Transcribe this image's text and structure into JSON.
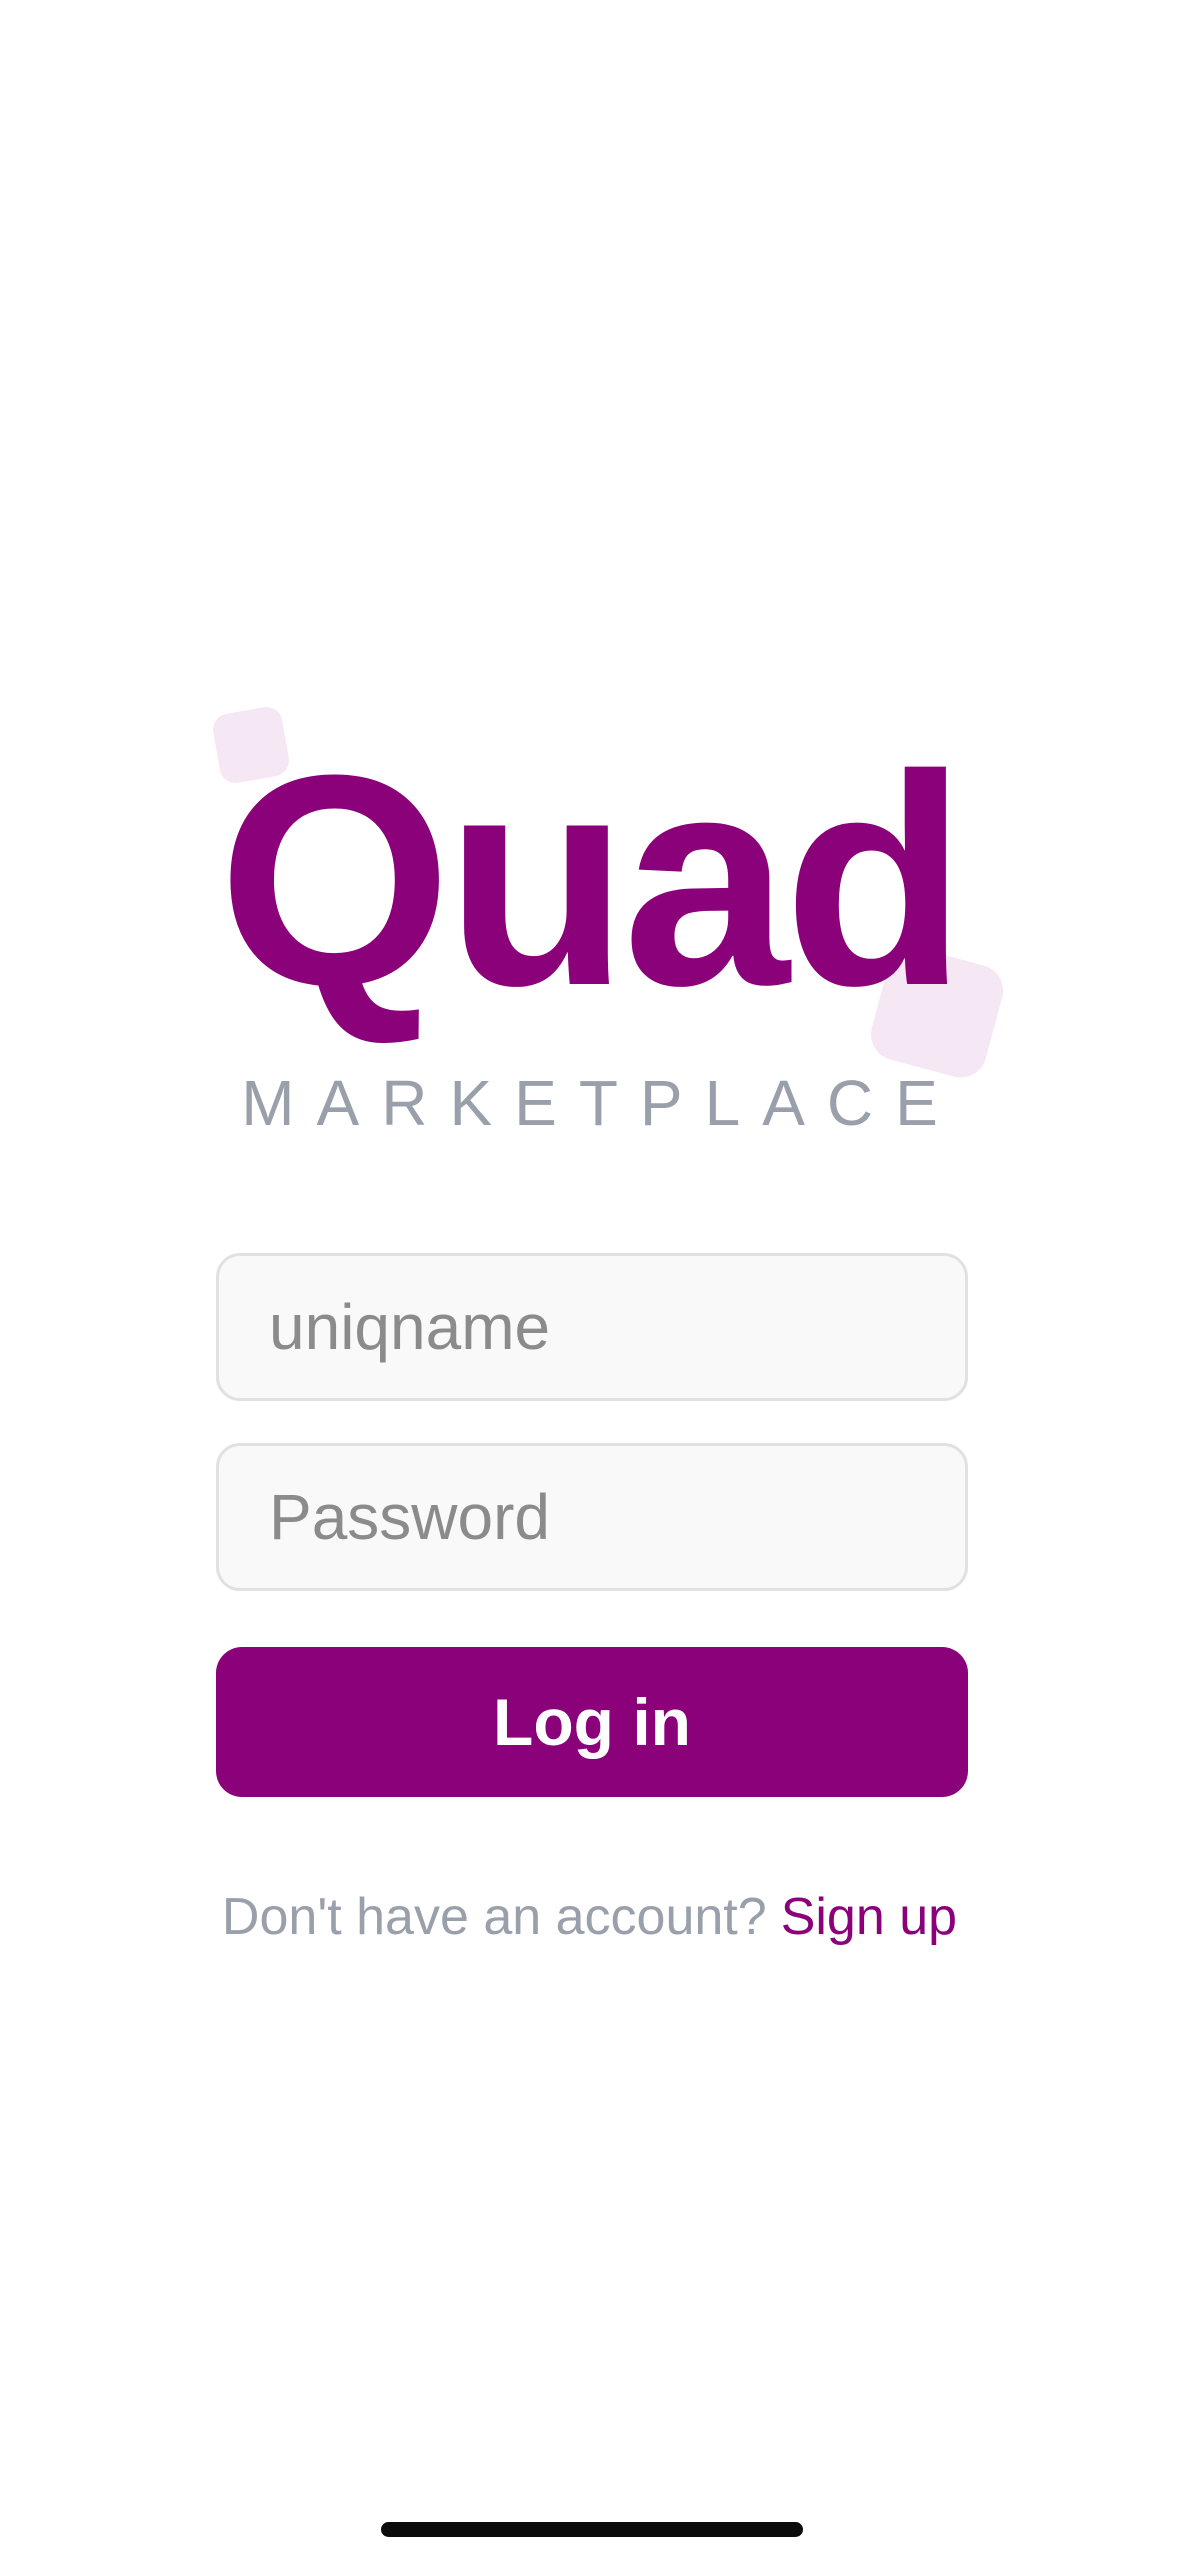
{
  "brand": {
    "title": "Quad",
    "subtitle": "MARKETPLACE"
  },
  "login_form": {
    "username_placeholder": "uniqname",
    "password_placeholder": "Password",
    "submit_label": "Log in"
  },
  "signup": {
    "prompt": "Don't have an account?",
    "link_label": "Sign up"
  },
  "colors": {
    "accent": "#8a0179",
    "muted_text": "#9aa0ab",
    "decor": "#f5e7f3",
    "field_bg": "#f9f9f9",
    "field_border": "#e1e1e1"
  }
}
